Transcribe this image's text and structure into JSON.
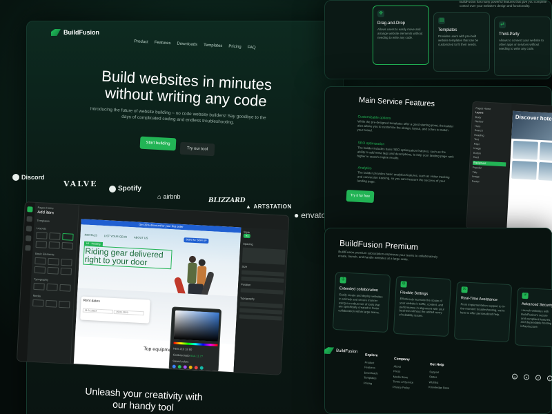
{
  "brand": {
    "name": "BuildFusion"
  },
  "nav": {
    "items": [
      "Product",
      "Features",
      "Downloads",
      "Templates",
      "Pricing",
      "FAQ"
    ]
  },
  "hero": {
    "title": "Build websites in minutes without writing any code",
    "subtitle": "Introducing the future of website building – no code website builders! Say goodbye to the days of complicated coding and endless troubleshooting.",
    "primary_button": "Start building",
    "secondary_button": "Try our tool"
  },
  "logos": [
    "Discord",
    "VALVE",
    "Spotify",
    "airbnb",
    "BLIZZARD",
    "ARTSTATION",
    "envato"
  ],
  "builder": {
    "breadcrumb": "Pages  Home",
    "panel_title": "Add item",
    "templates_label": "Templates",
    "layouts_label": "Layouts",
    "basic_label": "Basic Elements",
    "typography_label": "Typography",
    "media_label": "Media",
    "canvas_banner": "Get 15% discount for your first order",
    "canvas_nav": [
      "RENTALS",
      "LIST YOUR GEAR",
      "ABOUT US"
    ],
    "canvas_cta": "SIGN IN / SIGN UP",
    "canvas_tag": "H1 · Heading",
    "canvas_heading": "Riding gear delivered right to your door",
    "rent_title": "Rent dates",
    "rent_from": "11.01.2023",
    "rent_to": "15.01.2023",
    "section_title": "Top equipment",
    "style_label": "Style",
    "spacing_label": "Spacing",
    "size_label": "Size",
    "position_label": "Position",
    "typography_right_label": "Typography",
    "color_format": "HEX",
    "color_value": "213 18 80",
    "contrast_label": "Contrast ratio",
    "contrast_value": "AAA 11.77",
    "saved_label": "Saved colors",
    "saved_colors": [
      "#3b82f6",
      "#22c55e",
      "#a855f7",
      "#eab308",
      "#ef4444",
      "#14b8a6"
    ],
    "accent": "#22b455"
  },
  "bottom_heading": "Unleash your creativity with our handy tool",
  "top_right": {
    "intro": "BuildFusion has many powerful features that give you complete control over your website's design and functionality.",
    "cards": [
      {
        "title": "Drag-and-Drop",
        "text": "Allows users to easily move and arrange website elements without needing to write any code."
      },
      {
        "title": "Templates",
        "text": "Provides users with pre-built website templates that can be customized to fit their needs."
      },
      {
        "title": "Third-Party",
        "text": "Allows to connect your website to other apps or services without needing to write any code."
      }
    ]
  },
  "main_features": {
    "title": "Main Service Features",
    "blocks": [
      {
        "title": "Customizable options",
        "text": "While the pre-designed templates offer a good starting point, the builder also allows you to customize the design, layout, and colors to match your brand."
      },
      {
        "title": "SEO optimization",
        "text": "The builder includes basic SEO optimization features, such as the ability to add meta tags and descriptions, to help your landing page rank higher in search engine results."
      },
      {
        "title": "Analytics",
        "text": "The builder provides basic analytics features, such as visitor tracking and conversion tracking, so you can measure the success of your landing page."
      }
    ],
    "button": "Try it for free",
    "mini_app": {
      "breadcrumb": "Pages  Home",
      "layers_label": "Layers",
      "layers": [
        "Body",
        "Navbar",
        "Hero",
        "Search",
        "Heading",
        "Text",
        "Filter",
        "Image",
        "Button",
        "Card",
        "Equipment",
        "Popular",
        "Title",
        "Image",
        "Footer"
      ],
      "hero_text": "Discover hotels a"
    }
  },
  "premium": {
    "title": "BuildFusion Premium",
    "subtitle": "BuildFusion premium subscription empowers your teams to collaboratively create, launch, and handle websites at a large scale.",
    "cards": [
      {
        "title": "Extended collaboration",
        "text": "Easily create and deploy websites in a timely and secure manner using our robust set of tools that are specifically created to foster collaboration within large teams."
      },
      {
        "title": "Flexible Settings",
        "text": "Effortlessly increase the scope of your website's traffic, content, and performance in alignment with your business without the added worry of reliability issues."
      },
      {
        "title": "Real-Time Assistance",
        "text": "From implementation support to in-the-moment troubleshooting, we're here to offer personalized help."
      },
      {
        "title": "Advanced Security",
        "text": "Launch websites with BuildFusion's secure and compliant features, and dependable hosting infrastructure."
      }
    ]
  },
  "footer": {
    "columns": [
      {
        "title": "Explore",
        "items": [
          "Product",
          "Features",
          "Downloads",
          "Templates",
          "Pricing",
          "FAQ"
        ]
      },
      {
        "title": "Company",
        "items": [
          "About",
          "Press",
          "Media Store",
          "Terms of Service",
          "Privacy Policy",
          "Cookie Policy"
        ]
      },
      {
        "title": "Get Help",
        "items": [
          "Support",
          "Status",
          "Wishlist",
          "Knowledge Base",
          "Forum",
          "Discord"
        ]
      }
    ],
    "socials": [
      "instagram-icon",
      "discord-icon",
      "facebook-icon",
      "twitter-icon"
    ]
  }
}
